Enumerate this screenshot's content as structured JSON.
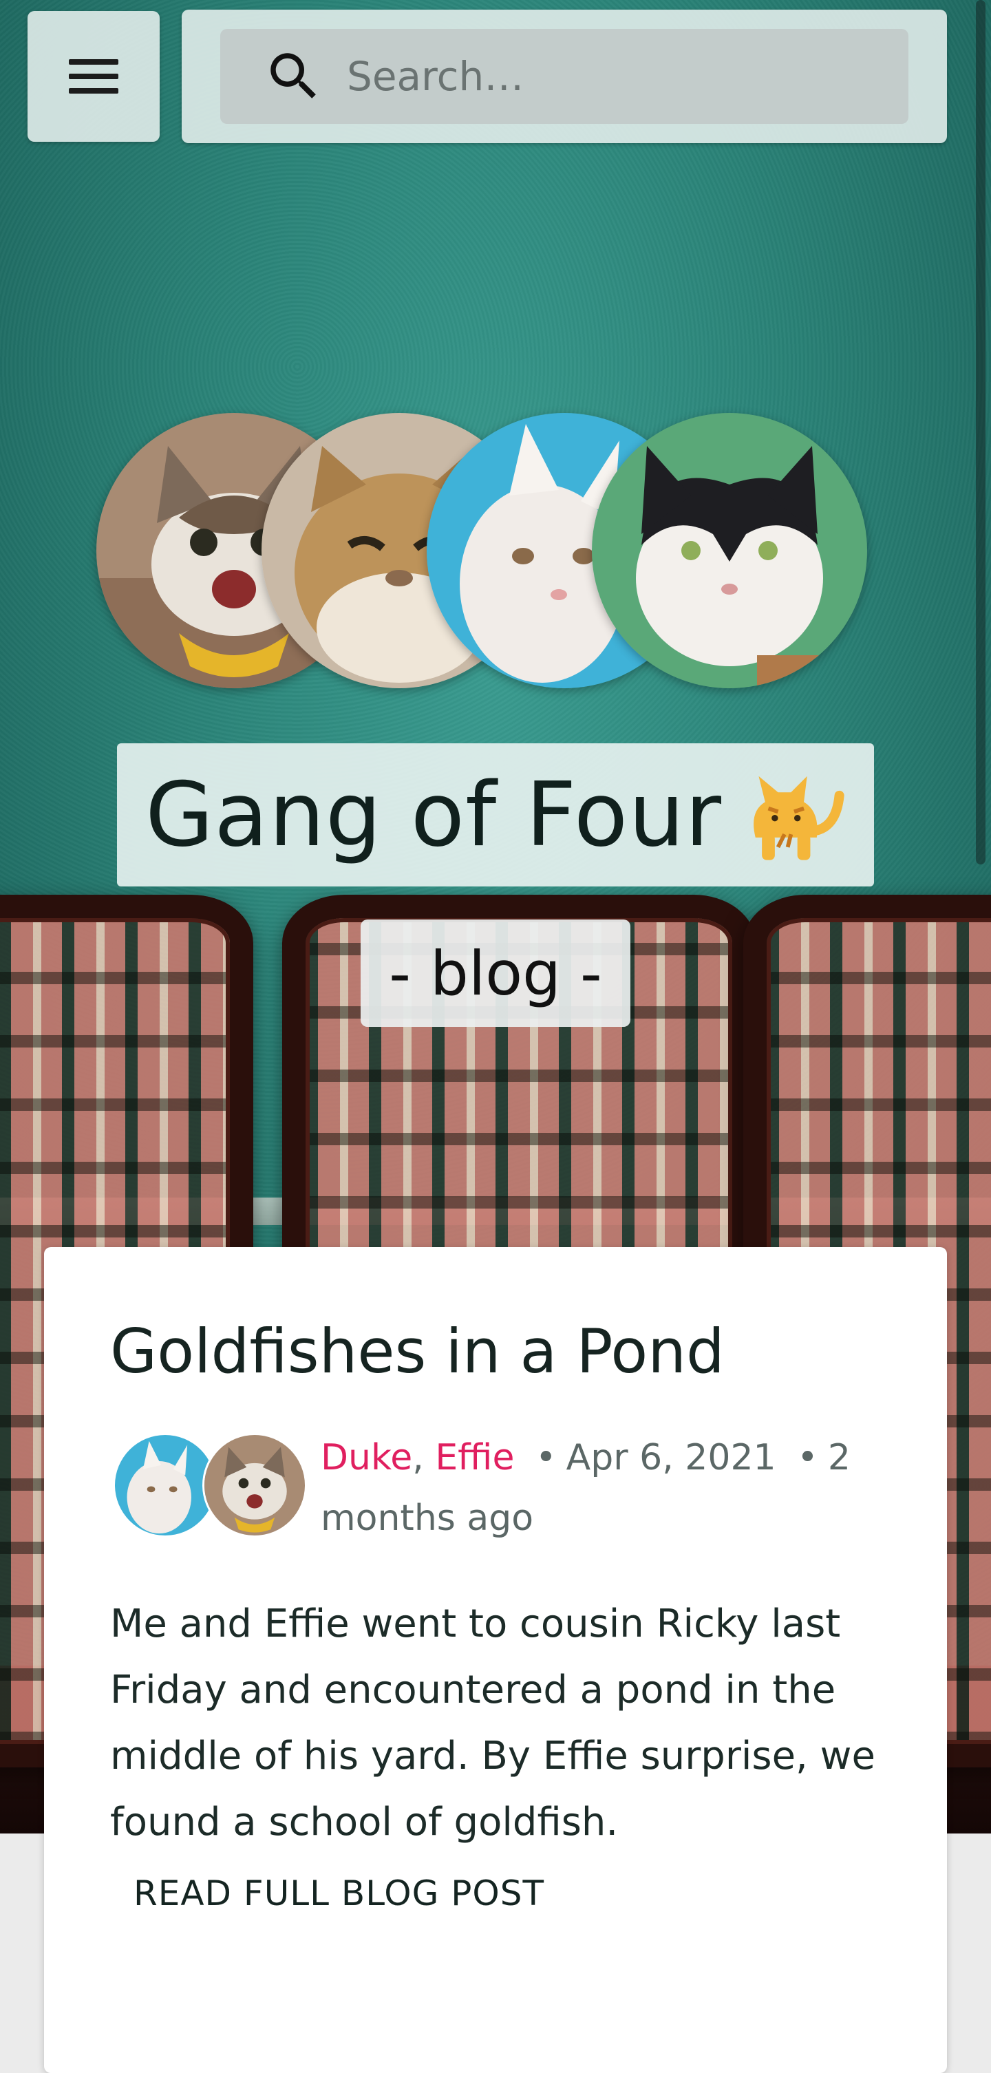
{
  "search": {
    "placeholder": "Search…"
  },
  "hero": {
    "title": "Gang of Four",
    "title_emoji": "cat-emoji",
    "subtitle": "- blog -"
  },
  "post": {
    "title": "Goldfishes in a Pond",
    "authors": [
      "Duke",
      "Effie"
    ],
    "author_separator": ",",
    "date": "Apr 6, 2021",
    "relative_time": "2 months ago",
    "excerpt": "Me and Effie went to cousin Ricky last Friday and encountered a pond in the middle of his yard. By Effie surprise, we found a school of goldfish.",
    "read_more": "READ FULL BLOG POST"
  },
  "colors": {
    "author_link": "#e01f5f",
    "wall": "#2a8277",
    "card": "#ffffff"
  },
  "icons": [
    "menu-icon",
    "search-icon",
    "cat-emoji"
  ]
}
